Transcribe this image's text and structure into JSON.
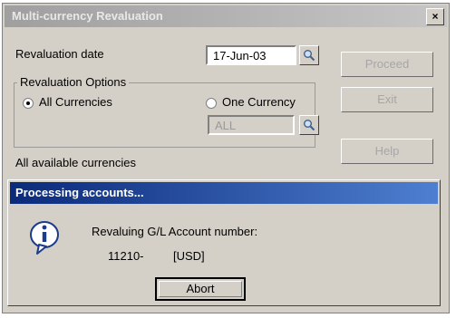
{
  "window": {
    "title": "Multi-currency Revaluation",
    "close_glyph": "×",
    "revaluation_date_label": "Revaluation date",
    "revaluation_date_value": "17-Jun-03",
    "group_label": "Revaluation Options",
    "all_currencies_label": "All Currencies",
    "one_currency_label": "One Currency",
    "currency_value": "ALL",
    "status_text": "All available currencies",
    "proceed_label": "Proceed",
    "exit_label": "Exit",
    "help_label": "Help",
    "selected_option": "All Currencies"
  },
  "dialog": {
    "title": "Processing accounts...",
    "message": "Revaluing G/L Account number:",
    "account_number": "11210-",
    "currency": "[USD]",
    "abort_label": "Abort",
    "icon": "info-icon"
  }
}
